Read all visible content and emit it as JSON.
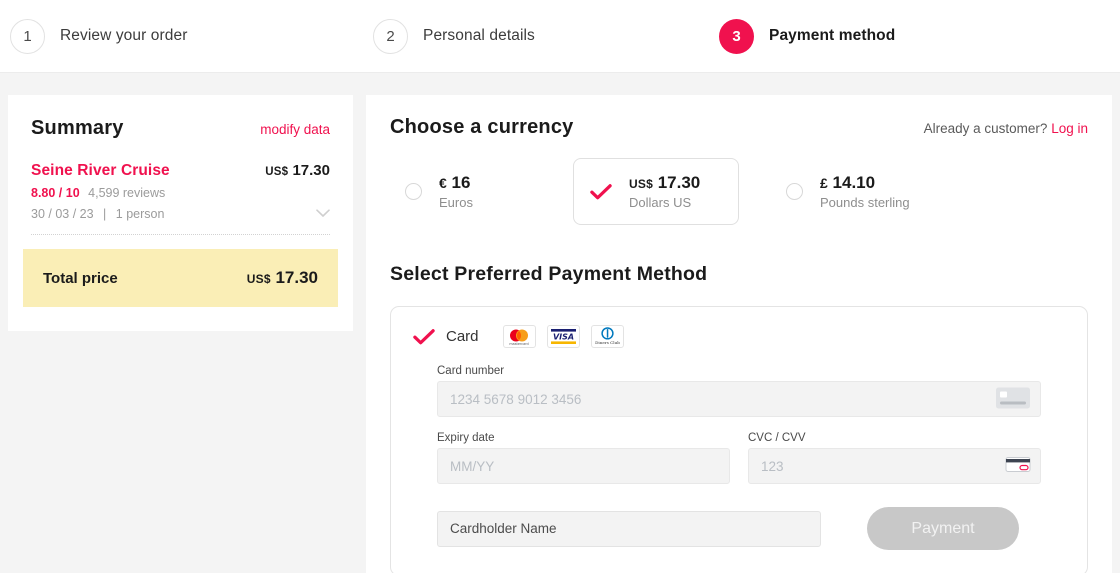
{
  "stepper": {
    "steps": [
      {
        "number": "1",
        "label": "Review your order",
        "active": false
      },
      {
        "number": "2",
        "label": "Personal details",
        "active": false
      },
      {
        "number": "3",
        "label": "Payment method",
        "active": true
      }
    ]
  },
  "summary": {
    "title": "Summary",
    "modify_label": "modify data",
    "item": {
      "name": "Seine River Cruise",
      "price_currency": "US$",
      "price_amount": "17.30",
      "rating": "8.80 / 10",
      "reviews": "4,599 reviews",
      "date": "30 / 03 / 23",
      "separator": "|",
      "persons": "1 person",
      "chevron": "chevron-down-icon"
    },
    "total": {
      "label": "Total price",
      "currency": "US$",
      "amount": "17.30"
    }
  },
  "main": {
    "currency_title": "Choose a currency",
    "login_prompt": "Already a customer?",
    "login_link": "Log in",
    "currencies": [
      {
        "symbol": "€",
        "amount": "16",
        "name": "Euros",
        "selected": false,
        "code": ""
      },
      {
        "symbol": "",
        "amount": "17.30",
        "name": "Dollars US",
        "selected": true,
        "code": "US$"
      },
      {
        "symbol": "£",
        "amount": "14.10",
        "name": "Pounds sterling",
        "selected": false,
        "code": ""
      }
    ],
    "payment_title": "Select Preferred Payment Method",
    "card_option": {
      "label": "Card",
      "selected": true,
      "brands": [
        "mastercard-logo",
        "visa-logo",
        "diners-club-logo"
      ]
    },
    "fields": {
      "card_number_label": "Card number",
      "card_number_placeholder": "1234 5678 9012 3456",
      "expiry_label": "Expiry date",
      "expiry_placeholder": "MM/YY",
      "cvc_label": "CVC / CVV",
      "cvc_placeholder": "123",
      "cardholder_placeholder": "Cardholder Name"
    },
    "submit_label": "Payment"
  },
  "colors": {
    "accent": "#f0114e",
    "page_bg": "#f4f4f4",
    "total_bg": "#faeeb6",
    "disabled_btn": "#c8c8c8"
  }
}
